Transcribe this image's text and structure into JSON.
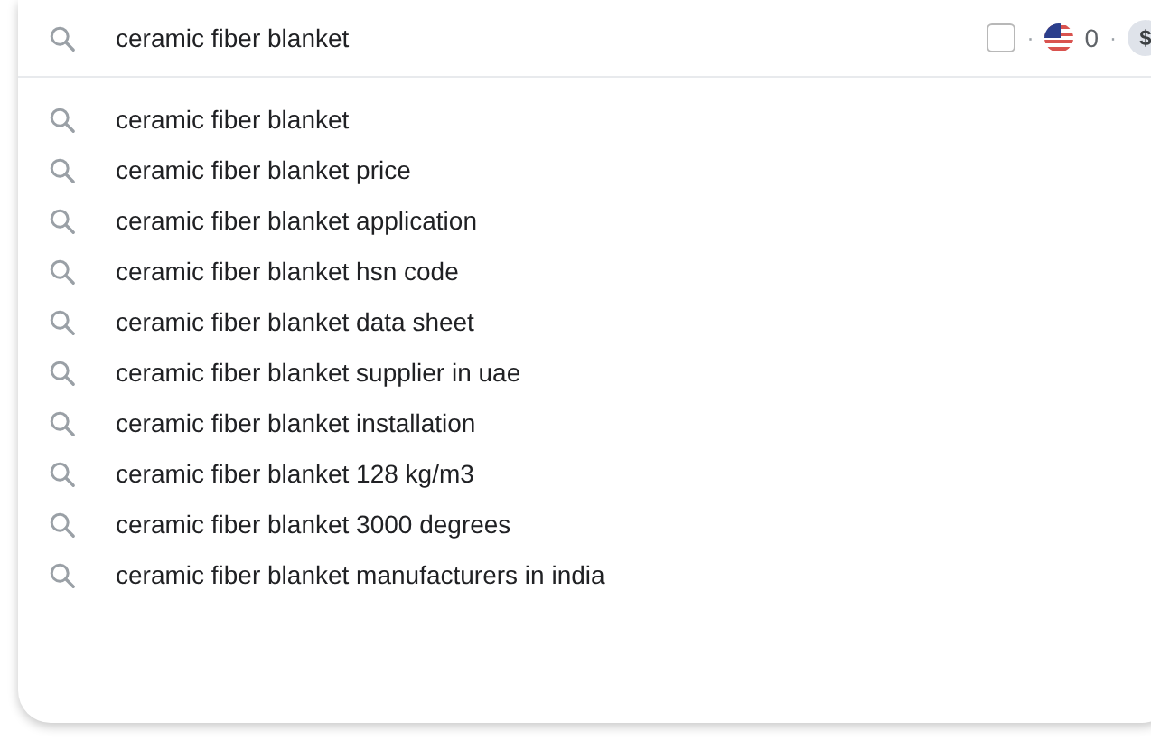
{
  "search": {
    "value": "ceramic fiber blanket",
    "checkbox": {
      "checked": false
    },
    "separator_1": "·",
    "count": "0",
    "separator_2": "·",
    "currency": "$"
  },
  "suggestions": [
    {
      "text": "ceramic fiber blanket"
    },
    {
      "text": "ceramic fiber blanket price"
    },
    {
      "text": "ceramic fiber blanket application"
    },
    {
      "text": "ceramic fiber blanket hsn code"
    },
    {
      "text": "ceramic fiber blanket data sheet"
    },
    {
      "text": "ceramic fiber blanket supplier in uae"
    },
    {
      "text": "ceramic fiber blanket installation"
    },
    {
      "text": "ceramic fiber blanket 128 kg/m3"
    },
    {
      "text": "ceramic fiber blanket 3000 degrees"
    },
    {
      "text": "ceramic fiber blanket manufacturers in india"
    }
  ]
}
